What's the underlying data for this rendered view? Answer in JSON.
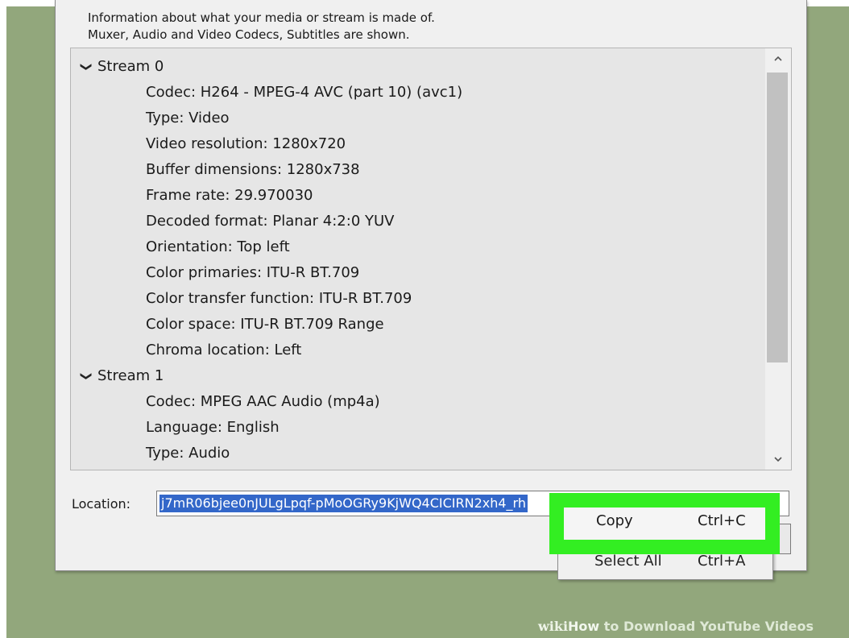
{
  "dialog": {
    "description_line1": "Information about what your media or stream is made of.",
    "description_line2": "Muxer, Audio and Video Codecs, Subtitles are shown."
  },
  "tree": {
    "rows": [
      {
        "label": "Stream 0"
      },
      {
        "label": "Codec: H264 - MPEG-4 AVC (part 10) (avc1)"
      },
      {
        "label": "Type: Video"
      },
      {
        "label": "Video resolution: 1280x720"
      },
      {
        "label": "Buffer dimensions: 1280x738"
      },
      {
        "label": "Frame rate: 29.970030"
      },
      {
        "label": "Decoded format: Planar 4:2:0 YUV"
      },
      {
        "label": "Orientation: Top left"
      },
      {
        "label": "Color primaries: ITU-R BT.709"
      },
      {
        "label": "Color transfer function: ITU-R BT.709"
      },
      {
        "label": "Color space: ITU-R BT.709 Range"
      },
      {
        "label": "Chroma location: Left"
      },
      {
        "label": "Stream 1"
      },
      {
        "label": "Codec: MPEG AAC Audio (mp4a)"
      },
      {
        "label": "Language: English"
      },
      {
        "label": "Type: Audio"
      }
    ],
    "expand_glyph": "❯"
  },
  "location": {
    "label": "Location:",
    "value": "j7mR06bjee0nJULgLpqf-pMoOGRy9KjWQ4CICIRN2xh4_rh"
  },
  "context_menu": {
    "copy_label": "Copy",
    "copy_shortcut": "Ctrl+C",
    "select_all_label": "Select All",
    "select_all_shortcut": "Ctrl+A"
  },
  "watermark": {
    "wiki": "wiki",
    "how": "How",
    "rest": " to Download YouTube Videos"
  },
  "colors": {
    "background": "#92a77c",
    "selection": "#3367c9",
    "highlight": "#33ee22"
  }
}
